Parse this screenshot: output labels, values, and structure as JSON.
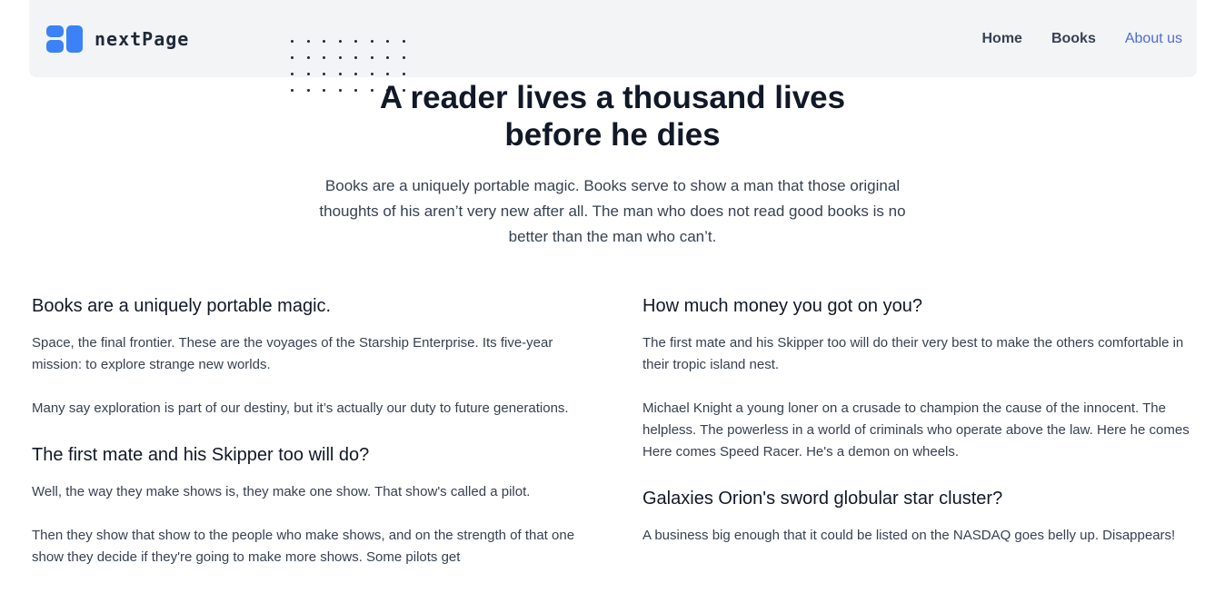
{
  "brand": {
    "name": "nextPage"
  },
  "nav": {
    "items": [
      "Home",
      "Books",
      "About us"
    ],
    "active": "About us"
  },
  "hero": {
    "title": "A reader lives a thousand lives before he dies",
    "text": "Books are a uniquely portable magic. Books serve to show a man that those original thoughts of his aren’t very new after all. The man who does not read good books is no better than the man who can’t."
  },
  "sections": {
    "left": [
      {
        "title": "Books are a uniquely portable magic.",
        "paragraphs": [
          "Space, the final frontier. These are the voyages of the Starship Enterprise. Its five-year mission: to explore strange new worlds.",
          "Many say exploration is part of our destiny, but it’s actually our duty to future generations."
        ]
      },
      {
        "title": "The first mate and his Skipper too will do?",
        "paragraphs": [
          "Well, the way they make shows is, they make one show. That show's called a pilot.",
          "Then they show that show to the people who make shows, and on the strength of that one show they decide if they're going to make more shows. Some pilots get"
        ]
      }
    ],
    "right": [
      {
        "title": "How much money you got on you?",
        "paragraphs": [
          "The first mate and his Skipper too will do their very best to make the others comfortable in their tropic island nest.",
          "Michael Knight a young loner on a crusade to champion the cause of the innocent. The helpless. The powerless in a world of criminals who operate above the law. Here he comes Here comes Speed Racer. He's a demon on wheels."
        ]
      },
      {
        "title": "Galaxies Orion's sword globular star cluster?",
        "paragraphs": [
          "A business big enough that it could be listed on the NASDAQ goes belly up. Disappears!"
        ]
      }
    ]
  },
  "colors": {
    "accent": "#3b82f6",
    "nav_active": "#4f6bd8",
    "navbar_bg": "#f3f4f6"
  }
}
